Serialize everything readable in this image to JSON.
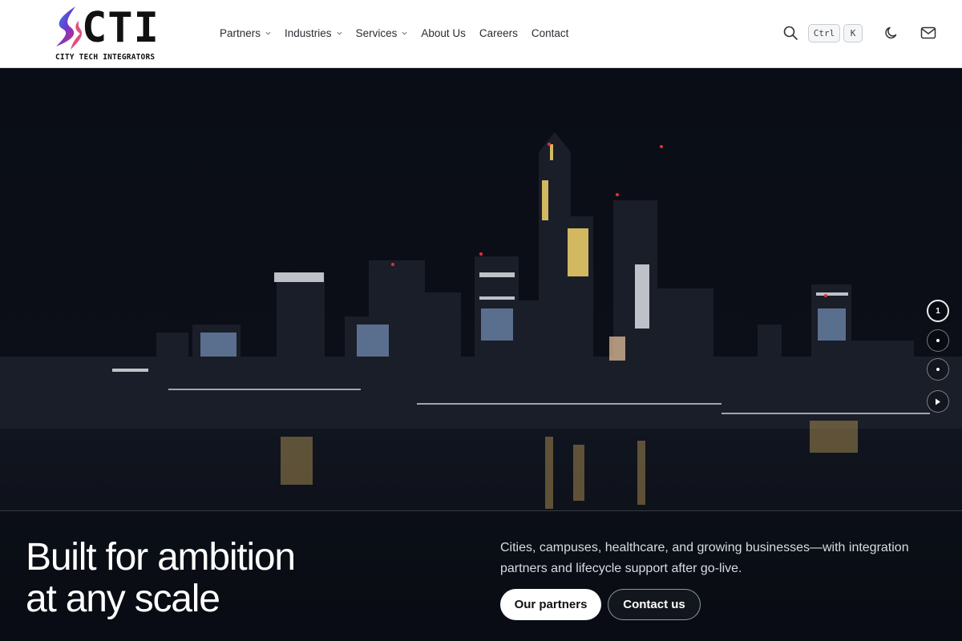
{
  "brand": {
    "logo_letters": "CTI",
    "logo_subtitle": "CITY TECH INTEGRATORS"
  },
  "nav": {
    "items": [
      {
        "label": "Partners",
        "has_dropdown": true
      },
      {
        "label": "Industries",
        "has_dropdown": true
      },
      {
        "label": "Services",
        "has_dropdown": true
      },
      {
        "label": "About Us",
        "has_dropdown": false
      },
      {
        "label": "Careers",
        "has_dropdown": false
      },
      {
        "label": "Contact",
        "has_dropdown": false
      }
    ]
  },
  "tools": {
    "search_icon": "search-icon",
    "shortcut_ctrl": "Ctrl",
    "shortcut_k": "K",
    "theme_icon": "moon-icon",
    "mail_icon": "mail-icon"
  },
  "hero": {
    "headline_line1": "Built for ambition",
    "headline_line2": "at any scale",
    "description": "Cities, campuses, healthcare, and growing businesses—with integration partners and lifecycle support after go-live.",
    "primary_cta": "Our partners",
    "secondary_cta": "Contact us",
    "slides": {
      "active_label": "1",
      "total": 3,
      "play_icon": "play-icon"
    }
  },
  "colors": {
    "header_bg": "#ffffff",
    "hero_bg": "#0b0e16",
    "logo_blue": "#2c7be5",
    "logo_magenta": "#d6246e"
  }
}
